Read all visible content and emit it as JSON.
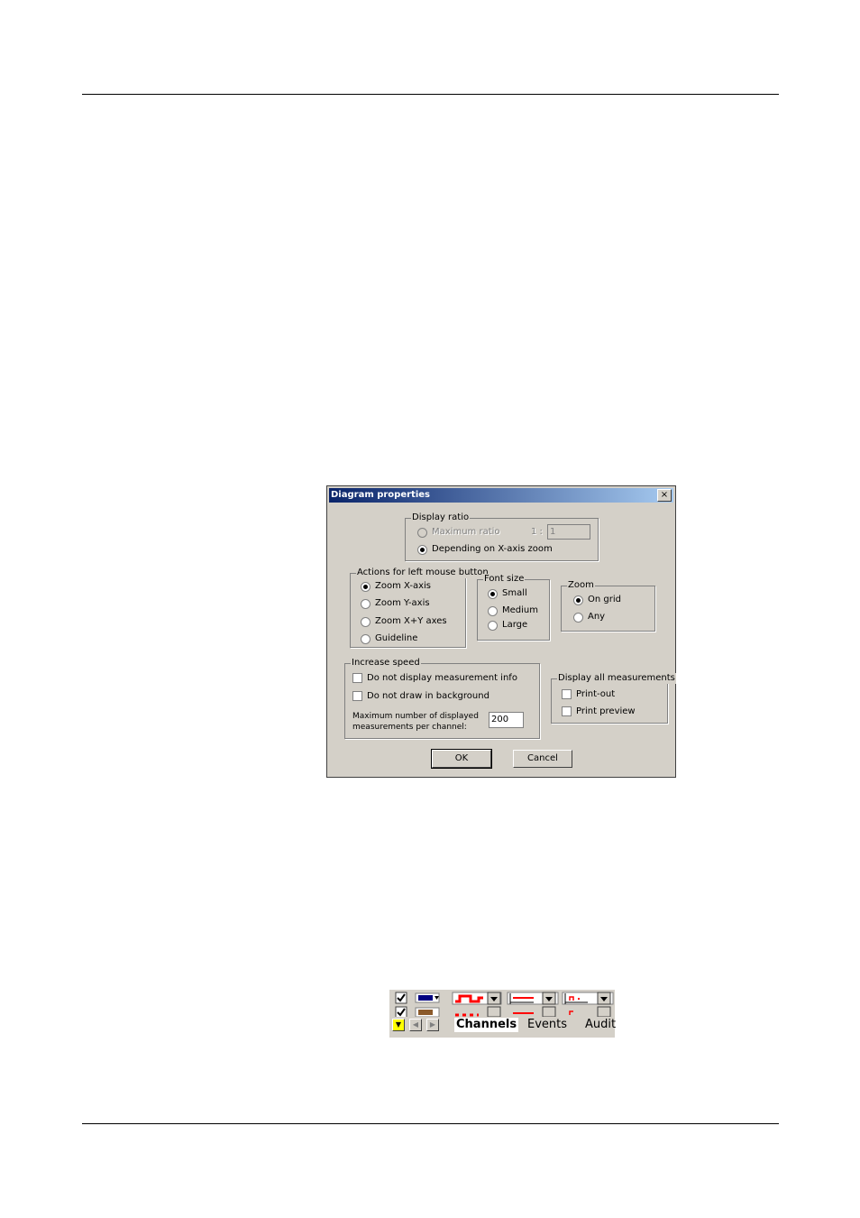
{
  "dialog": {
    "title": "Diagram properties",
    "close_glyph": "×",
    "display_ratio": {
      "legend": "Display ratio",
      "max_ratio_label": "Maximum ratio",
      "ratio_prefix": "1 :",
      "ratio_value": "1",
      "depending_label": "Depending on X-axis zoom",
      "selected": "Depending on X-axis zoom"
    },
    "left_mouse": {
      "legend": "Actions for left mouse button",
      "options": [
        "Zoom X-axis",
        "Zoom Y-axis",
        "Zoom X+Y axes",
        "Guideline"
      ],
      "selected": "Zoom X-axis"
    },
    "font_size": {
      "legend": "Font size",
      "options": [
        "Small",
        "Medium",
        "Large"
      ],
      "selected": "Small"
    },
    "zoom": {
      "legend": "Zoom",
      "options": [
        "On grid",
        "Any"
      ],
      "selected": "On grid"
    },
    "increase_speed": {
      "legend": "Increase speed",
      "no_info_label": "Do not display measurement info",
      "no_bg_label": "Do not draw in background",
      "max_label_line1": "Maximum number of displayed",
      "max_label_line2": "measurements per channel:",
      "max_value": "200"
    },
    "display_all": {
      "legend": "Display all measurements",
      "printout_label": "Print-out",
      "preview_label": "Print preview"
    },
    "ok_label": "OK",
    "cancel_label": "Cancel"
  },
  "toolbar": {
    "tabs": [
      "Channels",
      "Events",
      "Audit"
    ],
    "active_tab": "Channels",
    "colors": {
      "swatch1": "#000080",
      "swatch2": "#8b5a2b",
      "trace": "#ff0000",
      "highlight": "#ffff00"
    }
  }
}
